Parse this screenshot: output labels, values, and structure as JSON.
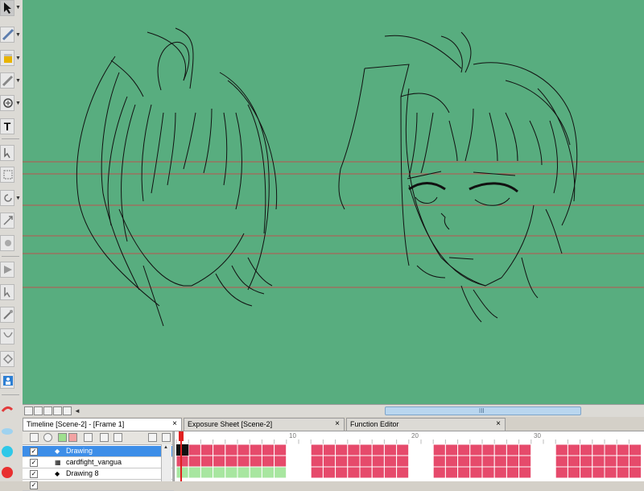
{
  "toolbar": {
    "tools": [
      {
        "name": "selection-tool-icon"
      },
      {
        "name": "cutter-tool-icon"
      },
      {
        "name": "paint-tool-icon"
      },
      {
        "name": "pencil-tool-icon"
      },
      {
        "name": "contour-editor-icon"
      },
      {
        "name": "text-tool-icon"
      },
      {
        "name": "transform-tool-icon"
      },
      {
        "name": "scale-tool-icon"
      },
      {
        "name": "rotate-tool-icon"
      },
      {
        "name": "skew-tool-icon"
      },
      {
        "name": "hand-tool-icon"
      },
      {
        "name": "zoom-tool-icon"
      },
      {
        "name": "eraser-tool-icon"
      },
      {
        "name": "pen-tool-icon"
      },
      {
        "name": "stroke-tool-icon"
      },
      {
        "name": "morph-tool-icon"
      },
      {
        "name": "camera-tool-icon"
      },
      {
        "name": "cloud-tool-icon"
      },
      {
        "name": "color-swatch-icon"
      },
      {
        "name": "record-icon"
      }
    ],
    "text_tool_label": "T"
  },
  "tabs": [
    {
      "label": "Timeline [Scene-2] - [Frame 1]",
      "active": true,
      "close": "×"
    },
    {
      "label": "Exposure Sheet [Scene-2]",
      "active": false,
      "close": "×"
    },
    {
      "label": "Function Editor",
      "active": false,
      "close": "×"
    }
  ],
  "timeline": {
    "layers": [
      {
        "name": "Drawing",
        "selected": true,
        "checked": "✓",
        "icon": "◆"
      },
      {
        "name": "cardfight_vangua",
        "selected": false,
        "checked": "✓",
        "icon": "▦"
      },
      {
        "name": "Drawing 8",
        "selected": false,
        "checked": "✓",
        "icon": "◆"
      },
      {
        "name": "",
        "selected": false,
        "checked": "✓",
        "icon": ""
      }
    ],
    "frame_labels": [
      "10",
      "20",
      "30"
    ],
    "scrollbar_grip": "III",
    "scroll_left_arrow": "◄",
    "vscroll_up_arrow": "▲"
  },
  "colors": {
    "canvas": "#58ad7f",
    "guide_lines": "#c0392b",
    "frame_exposed": "#e64a6b",
    "frame_drawing_green": "#a8e6a0",
    "layer_selected": "#3d8ee8",
    "playhead": "#e02020"
  }
}
